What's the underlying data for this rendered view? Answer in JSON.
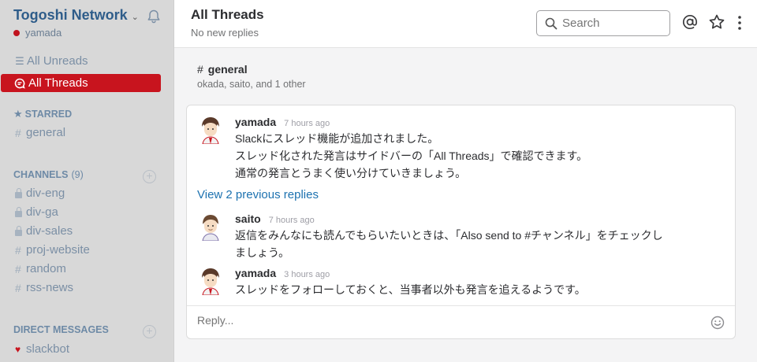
{
  "team": {
    "name": "Togoshi Network",
    "user": "yamada"
  },
  "nav": {
    "all_unreads": "All Unreads",
    "all_threads": "All Threads"
  },
  "starred": {
    "heading": "STARRED",
    "channels": [
      "general"
    ]
  },
  "channels": {
    "heading": "CHANNELS",
    "count": "(9)",
    "items": [
      {
        "name": "div-eng",
        "private": true
      },
      {
        "name": "div-ga",
        "private": true
      },
      {
        "name": "div-sales",
        "private": true
      },
      {
        "name": "proj-website",
        "private": false
      },
      {
        "name": "random",
        "private": false
      },
      {
        "name": "rss-news",
        "private": false
      }
    ]
  },
  "direct_messages": {
    "heading": "DIRECT MESSAGES",
    "items": [
      "slackbot"
    ]
  },
  "header": {
    "title": "All Threads",
    "subtitle": "No new replies",
    "search_placeholder": "Search"
  },
  "thread": {
    "channel": "general",
    "members": "okada, saito, and 1 other",
    "root": {
      "author": "yamada",
      "time": "7 hours ago",
      "lines": [
        "Slackにスレッド機能が追加されました。",
        "スレッド化された発言はサイドバーの「All Threads」で確認できます。",
        "通常の発言とうまく使い分けていきましょう。"
      ]
    },
    "previous_replies": "View 2 previous replies",
    "replies": [
      {
        "author": "saito",
        "time": "7 hours ago",
        "lines": [
          "返信をみんなにも読んでもらいたいときは、「Also send to #チャンネル」をチェックし",
          "ましょう。"
        ]
      },
      {
        "author": "yamada",
        "time": "3 hours ago",
        "lines": [
          "スレッドをフォローしておくと、当事者以外も発言を追えるようです。"
        ]
      }
    ],
    "reply_placeholder": "Reply..."
  },
  "colors": {
    "accent": "#c8141e",
    "link": "#1d72b0",
    "sidebar": "#d8d8d8",
    "team": "#2f5d8a"
  },
  "icons": [
    "bell-icon",
    "search-icon",
    "at-icon",
    "star-icon",
    "kebab-icon",
    "emoji-icon",
    "lock-icon",
    "heart-icon",
    "threads-icon",
    "unreads-icon"
  ]
}
